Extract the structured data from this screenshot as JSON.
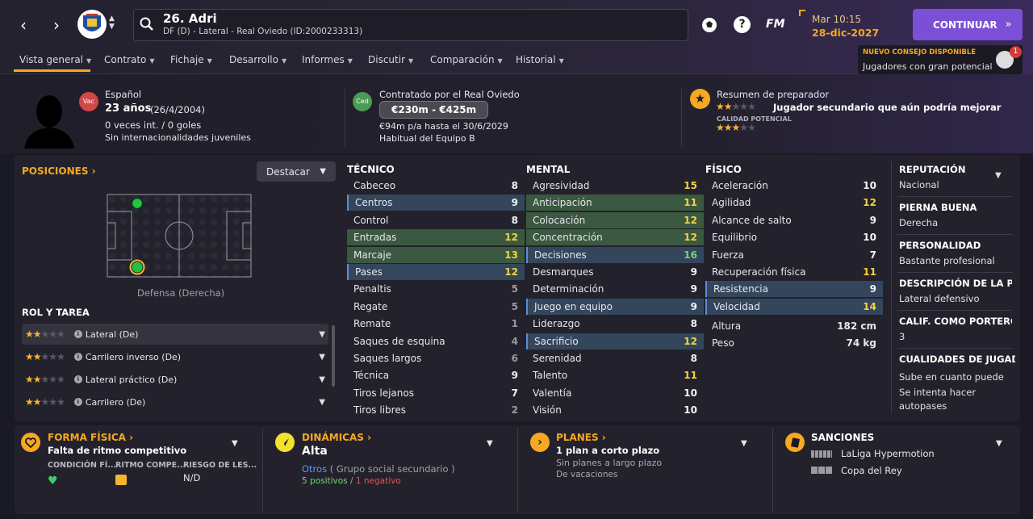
{
  "header": {
    "player_title": "26. Adri",
    "player_sub": "DF (D) - Lateral - Real Oviedo (ID:2000233313)",
    "fm_label": "FM",
    "help_label": "?",
    "date_time": "Mar 10:15",
    "date": "28-dic-2027",
    "continue_label": "CONTINUAR",
    "news_badge_title": "NUEVO CONSEJO DISPONIBLE",
    "news_badge_text": "Jugadores con gran potencial",
    "news_count": "1"
  },
  "tabs": [
    {
      "label": "Vista general"
    },
    {
      "label": "Contrato"
    },
    {
      "label": "Fichaje"
    },
    {
      "label": "Desarrollo"
    },
    {
      "label": "Informes"
    },
    {
      "label": "Discutir"
    },
    {
      "label": "Comparación"
    },
    {
      "label": "Historial"
    }
  ],
  "hero": {
    "nationality_badge": "Vac",
    "nationality": "Español",
    "age": "23 años",
    "dob": "(26/4/2004)",
    "caps": "0 veces int. / 0 goles",
    "youth_caps": "Sin internacionalidades juveniles",
    "contract_badge": "Ced",
    "contract_title": "Contratado por el Real Oviedo",
    "value_range": "€230m - €425m",
    "wage": "€94m p/a hasta el 30/6/2029",
    "squad_status": "Habitual del Equipo B",
    "coach_title": "Resumen de preparador",
    "coach_summary": "Jugador secundario que aún podría mejorar",
    "current_stars": 2,
    "potential_label": "CALIDAD POTENCIAL",
    "potential_stars": 3
  },
  "positions": {
    "title": "POSICIONES",
    "highlight_label": "Destacar",
    "pitch_caption": "Defensa (Derecha)",
    "role_title": "ROL Y TAREA",
    "roles": [
      {
        "name": "Lateral (De)",
        "stars": 2
      },
      {
        "name": "Carrilero inverso (De)",
        "stars": 2
      },
      {
        "name": "Lateral práctico (De)",
        "stars": 2
      },
      {
        "name": "Carrilero (De)",
        "stars": 2
      }
    ]
  },
  "technical": {
    "title": "TÉCNICO",
    "attrs": [
      {
        "name": "Cabeceo",
        "value": 8,
        "style": "",
        "color": "w"
      },
      {
        "name": "Centros",
        "value": 9,
        "style": "hl-blue mark",
        "color": "w"
      },
      {
        "name": "Control",
        "value": 8,
        "style": "",
        "color": "w"
      },
      {
        "name": "Entradas",
        "value": 12,
        "style": "hl-green",
        "color": "y"
      },
      {
        "name": "Marcaje",
        "value": 13,
        "style": "hl-green",
        "color": "y"
      },
      {
        "name": "Pases",
        "value": 12,
        "style": "hl-blue mark",
        "color": "y"
      },
      {
        "name": "Penaltis",
        "value": 5,
        "style": "",
        "color": "gr"
      },
      {
        "name": "Regate",
        "value": 5,
        "style": "",
        "color": "gr"
      },
      {
        "name": "Remate",
        "value": 1,
        "style": "",
        "color": "gr"
      },
      {
        "name": "Saques de esquina",
        "value": 4,
        "style": "",
        "color": "gr"
      },
      {
        "name": "Saques largos",
        "value": 6,
        "style": "",
        "color": "gr"
      },
      {
        "name": "Técnica",
        "value": 9,
        "style": "",
        "color": "w"
      },
      {
        "name": "Tiros lejanos",
        "value": 7,
        "style": "",
        "color": "w"
      },
      {
        "name": "Tiros libres",
        "value": 2,
        "style": "",
        "color": "gr"
      }
    ]
  },
  "mental": {
    "title": "MENTAL",
    "attrs": [
      {
        "name": "Agresividad",
        "value": 15,
        "style": "",
        "color": "y"
      },
      {
        "name": "Anticipación",
        "value": 11,
        "style": "hl-green",
        "color": "y"
      },
      {
        "name": "Colocación",
        "value": 12,
        "style": "hl-green",
        "color": "y"
      },
      {
        "name": "Concentración",
        "value": 12,
        "style": "hl-green",
        "color": "y"
      },
      {
        "name": "Decisiones",
        "value": 16,
        "style": "hl-blue mark",
        "color": "g"
      },
      {
        "name": "Desmarques",
        "value": 9,
        "style": "",
        "color": "w"
      },
      {
        "name": "Determinación",
        "value": 9,
        "style": "",
        "color": "w"
      },
      {
        "name": "Juego en equipo",
        "value": 9,
        "style": "hl-blue mark",
        "color": "w"
      },
      {
        "name": "Liderazgo",
        "value": 8,
        "style": "",
        "color": "w"
      },
      {
        "name": "Sacrificio",
        "value": 12,
        "style": "hl-blue mark",
        "color": "y"
      },
      {
        "name": "Serenidad",
        "value": 8,
        "style": "",
        "color": "w"
      },
      {
        "name": "Talento",
        "value": 11,
        "style": "",
        "color": "y"
      },
      {
        "name": "Valentía",
        "value": 10,
        "style": "",
        "color": "w"
      },
      {
        "name": "Visión",
        "value": 10,
        "style": "",
        "color": "w"
      }
    ]
  },
  "physical": {
    "title": "FÍSICO",
    "attrs": [
      {
        "name": "Aceleración",
        "value": 10,
        "style": "",
        "color": "w"
      },
      {
        "name": "Agilidad",
        "value": 12,
        "style": "",
        "color": "y"
      },
      {
        "name": "Alcance de salto",
        "value": 9,
        "style": "",
        "color": "w"
      },
      {
        "name": "Equilibrio",
        "value": 10,
        "style": "",
        "color": "w"
      },
      {
        "name": "Fuerza",
        "value": 7,
        "style": "",
        "color": "w"
      },
      {
        "name": "Recuperación física",
        "value": 11,
        "style": "",
        "color": "y"
      },
      {
        "name": "Resistencia",
        "value": 9,
        "style": "hl-blue mark",
        "color": "w"
      },
      {
        "name": "Velocidad",
        "value": 14,
        "style": "hl-blue mark",
        "color": "y"
      }
    ],
    "height_label": "Altura",
    "height": "182 cm",
    "weight_label": "Peso",
    "weight": "74 kg"
  },
  "info": {
    "items": [
      {
        "title": "REPUTACIÓN",
        "value": "Nacional"
      },
      {
        "title": "PIERNA BUENA",
        "value": "Derecha"
      },
      {
        "title": "PERSONALIDAD",
        "value": "Bastante profesional"
      },
      {
        "title": "DESCRIPCIÓN DE LA P...",
        "value": "Lateral defensivo"
      },
      {
        "title": "CALIF. COMO PORTERO",
        "value": "3"
      }
    ],
    "qualities_title": "CUALIDADES DE JUGADO",
    "qualities": [
      "Sube en cuanto puede",
      "Se intenta hacer autopases"
    ]
  },
  "bottom": {
    "fitness_title": "FORMA FÍSICA",
    "fitness_value": "Falta de ritmo competitivo",
    "fitness_cols": [
      "CONDICIÓN FÍ...",
      "RITMO COMPE...",
      "RIESGO DE LES..."
    ],
    "injury_risk": "N/D",
    "dynamics_title": "DINÁMICAS",
    "dynamics_value": "Alta",
    "dynamics_group": "Otros",
    "dynamics_group_desc": "( Grupo social secundario )",
    "positives": "5 positivos",
    "slash": "/",
    "negatives": "1 negativo",
    "plans_title": "PLANES",
    "plans_value": "1 plan a corto plazo",
    "plans_line2": "Sin planes a largo plazo",
    "plans_line3": "De vacaciones",
    "sanctions_title": "SANCIONES",
    "sanction_1": "LaLiga Hypermotion",
    "sanction_2": "Copa del Rey"
  },
  "colors": {
    "accent_orange": "#f6a821",
    "continue_purple": "#7b4fd6",
    "highlight_green": "#3b5840",
    "highlight_blue": "#34465c"
  }
}
